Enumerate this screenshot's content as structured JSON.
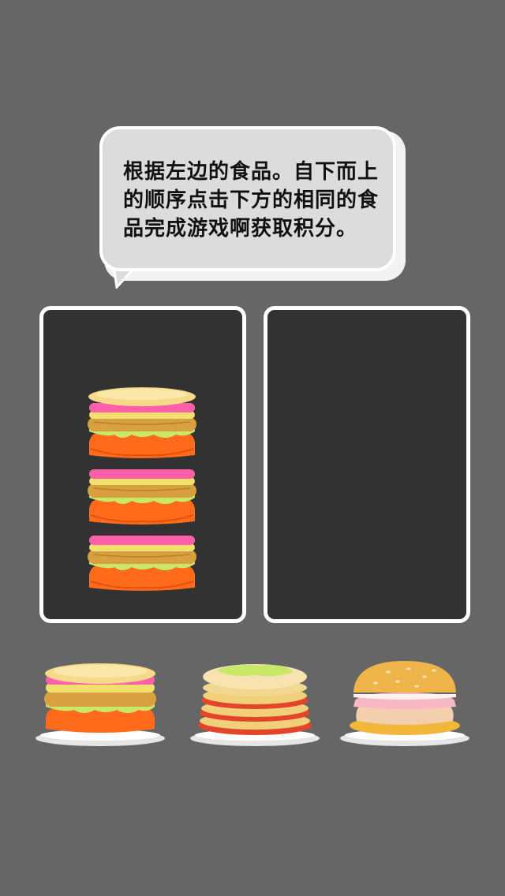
{
  "instruction": {
    "text": "根据左边的食品。自下而上的顺序点击下方的相同的食品完成游戏啊获取积分。"
  },
  "target_panel": {
    "stack_layers": 3,
    "stack_type": "pink-yellow-cake"
  },
  "answer_panel": {
    "stack_layers": 0
  },
  "choices": [
    {
      "id": "pink-yellow-cake",
      "icon": "pink-yellow-cake-icon"
    },
    {
      "id": "layered-pancake",
      "icon": "layered-pancake-icon"
    },
    {
      "id": "cream-bun",
      "icon": "cream-bun-icon"
    }
  ],
  "colors": {
    "background": "#666666",
    "panel": "#323232",
    "panel_border": "#ffffff",
    "bubble": "#dcdcdc",
    "cake_orange": "#ff6b1a",
    "cake_pink": "#ff5fa8",
    "cake_yellow": "#f7d98a",
    "cake_green": "#c8e86a"
  }
}
